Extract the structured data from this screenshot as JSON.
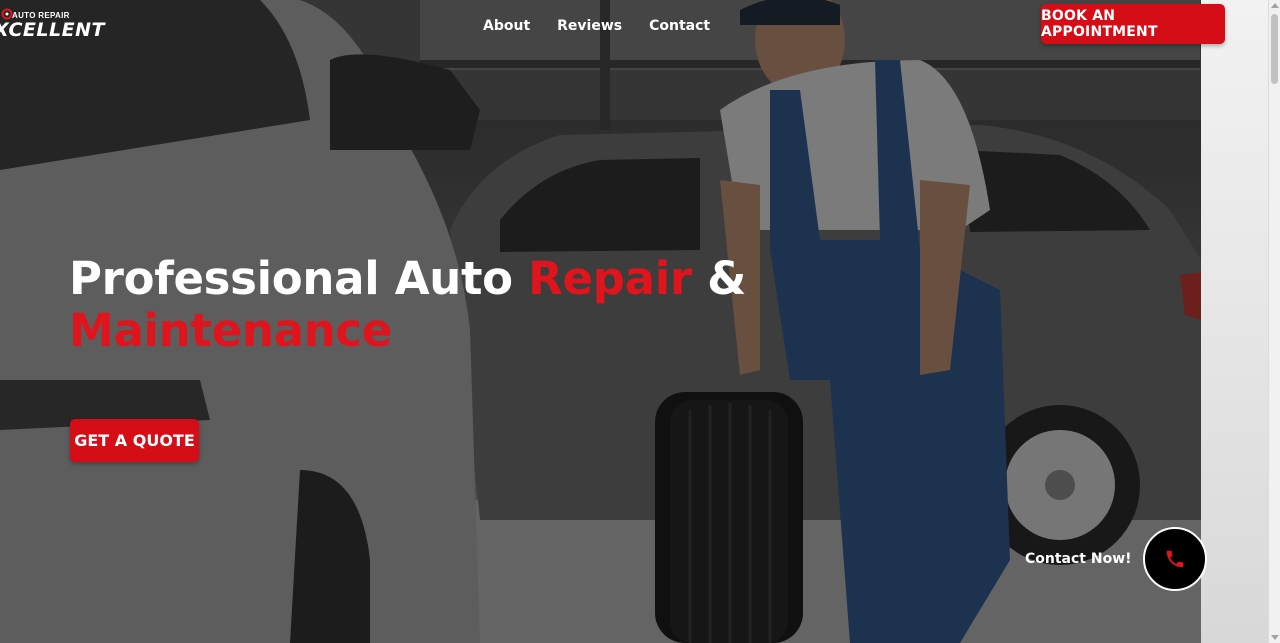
{
  "brand": {
    "tagline": "AUTO REPAIR",
    "name": "XCELLENT"
  },
  "nav": {
    "items": [
      {
        "label": "About"
      },
      {
        "label": "Reviews"
      },
      {
        "label": "Contact"
      }
    ]
  },
  "header": {
    "book_label": "BOOK AN APPOINTMENT"
  },
  "hero": {
    "headline_part1": "Professional Auto ",
    "headline_accent1": "Repair",
    "headline_part2": " &",
    "headline_accent2": "Maintenance",
    "quote_label": "GET A QUOTE"
  },
  "contact_widget": {
    "label": "Contact Now!",
    "icon": "phone-icon"
  },
  "colors": {
    "accent": "#d40d17",
    "headline_accent": "#e0141c",
    "text": "#ffffff",
    "phone_button_bg": "#000000"
  }
}
